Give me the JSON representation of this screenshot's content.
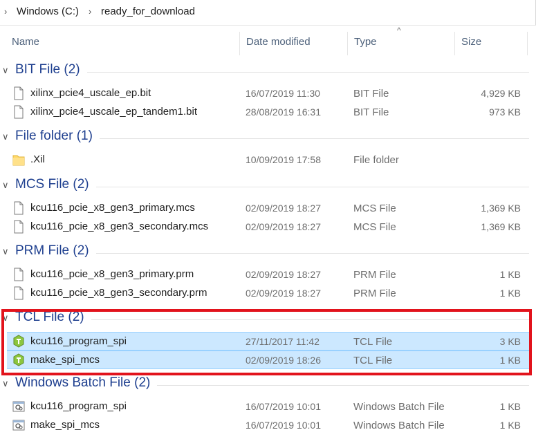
{
  "address": {
    "crumbs": [
      "Windows (C:)",
      "ready_for_download"
    ]
  },
  "columns": {
    "name": "Name",
    "date": "Date modified",
    "type": "Type",
    "size": "Size"
  },
  "groups": [
    {
      "title": "BIT File (2)",
      "rows": [
        {
          "name": "xilinx_pcie4_uscale_ep.bit",
          "date": "16/07/2019 11:30",
          "type": "BIT File",
          "size": "4,929 KB",
          "icon": "file-icon"
        },
        {
          "name": "xilinx_pcie4_uscale_ep_tandem1.bit",
          "date": "28/08/2019 16:31",
          "type": "BIT File",
          "size": "973 KB",
          "icon": "file-icon"
        }
      ]
    },
    {
      "title": "File folder (1)",
      "rows": [
        {
          "name": ".Xil",
          "date": "10/09/2019 17:58",
          "type": "File folder",
          "size": "",
          "icon": "folder-icon"
        }
      ]
    },
    {
      "title": "MCS File (2)",
      "rows": [
        {
          "name": "kcu116_pcie_x8_gen3_primary.mcs",
          "date": "02/09/2019 18:27",
          "type": "MCS File",
          "size": "1,369 KB",
          "icon": "file-icon"
        },
        {
          "name": "kcu116_pcie_x8_gen3_secondary.mcs",
          "date": "02/09/2019 18:27",
          "type": "MCS File",
          "size": "1,369 KB",
          "icon": "file-icon"
        }
      ]
    },
    {
      "title": "PRM File (2)",
      "rows": [
        {
          "name": "kcu116_pcie_x8_gen3_primary.prm",
          "date": "02/09/2019 18:27",
          "type": "PRM File",
          "size": "1 KB",
          "icon": "file-icon"
        },
        {
          "name": "kcu116_pcie_x8_gen3_secondary.prm",
          "date": "02/09/2019 18:27",
          "type": "PRM File",
          "size": "1 KB",
          "icon": "file-icon"
        }
      ]
    },
    {
      "title": "TCL File (2)",
      "rows": [
        {
          "name": "kcu116_program_spi",
          "date": "27/11/2017 11:42",
          "type": "TCL File",
          "size": "3 KB",
          "icon": "tcl-icon"
        },
        {
          "name": "make_spi_mcs",
          "date": "02/09/2019 18:26",
          "type": "TCL File",
          "size": "1 KB",
          "icon": "tcl-icon"
        }
      ]
    },
    {
      "title": "Windows Batch File (2)",
      "rows": [
        {
          "name": "kcu116_program_spi",
          "date": "16/07/2019 10:01",
          "type": "Windows Batch File",
          "size": "1 KB",
          "icon": "batch-icon"
        },
        {
          "name": "make_spi_mcs",
          "date": "16/07/2019 10:01",
          "type": "Windows Batch File",
          "size": "1 KB",
          "icon": "batch-icon"
        }
      ]
    }
  ],
  "colors": {
    "group_title": "#1e3f8f",
    "selection": "#cce8ff",
    "highlight_box": "#e2131c"
  }
}
